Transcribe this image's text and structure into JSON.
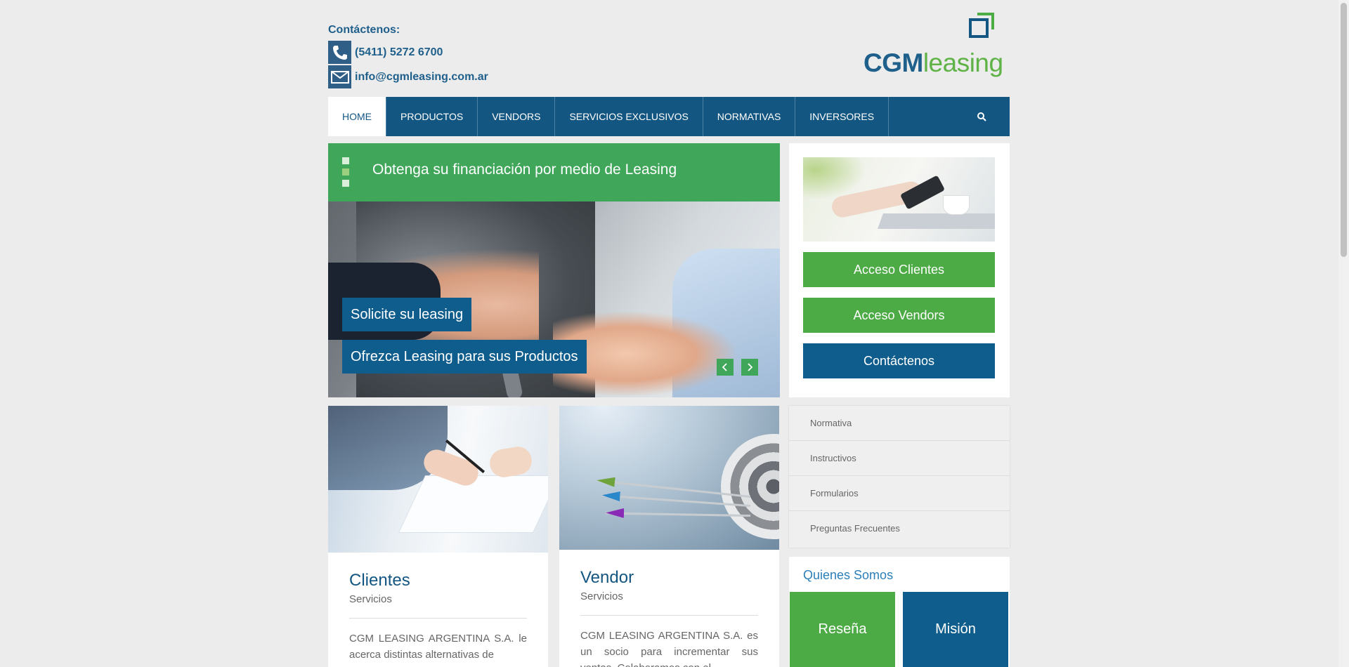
{
  "header": {
    "contact_title": "Contáctenos:",
    "phone": "(5411) 5272 6700",
    "email": "info@cgmleasing.com.ar",
    "logo_cgm": "CGM",
    "logo_leasing": "leasing"
  },
  "nav": {
    "items": [
      {
        "label": "HOME",
        "active": true
      },
      {
        "label": "PRODUCTOS"
      },
      {
        "label": "VENDORS"
      },
      {
        "label": "SERVICIOS EXCLUSIVOS"
      },
      {
        "label": "NORMATIVAS"
      },
      {
        "label": "INVERSORES"
      }
    ],
    "search_icon": "search-icon"
  },
  "slider": {
    "banner": "Obtenga su financiación por medio de Leasing",
    "cta1": "Solicite su leasing",
    "cta2": "Ofrezca Leasing para sus Productos",
    "prev": "‹",
    "next": "›"
  },
  "access": {
    "clientes": "Acceso Clientes",
    "vendors": "Acceso Vendors",
    "contact": "Contáctenos"
  },
  "cards": [
    {
      "title": "Clientes",
      "subtitle": "Servicios",
      "text": "CGM LEASING ARGENTINA S.A. le acerca distintas alternativas de"
    },
    {
      "title": "Vendor",
      "subtitle": "Servicios",
      "text": "CGM LEASING ARGENTINA S.A. es un socio para incrementar sus ventas. Colaboramos con el"
    }
  ],
  "links": [
    "Normativa",
    "Instructivos",
    "Formularios",
    "Preguntas Frecuentes"
  ],
  "about": {
    "heading": "Quienes Somos",
    "resena": "Reseña",
    "mision": "Misión"
  },
  "colors": {
    "brand_blue": "#145682",
    "brand_green": "#4cab45",
    "banner_green": "#3fa65a"
  }
}
